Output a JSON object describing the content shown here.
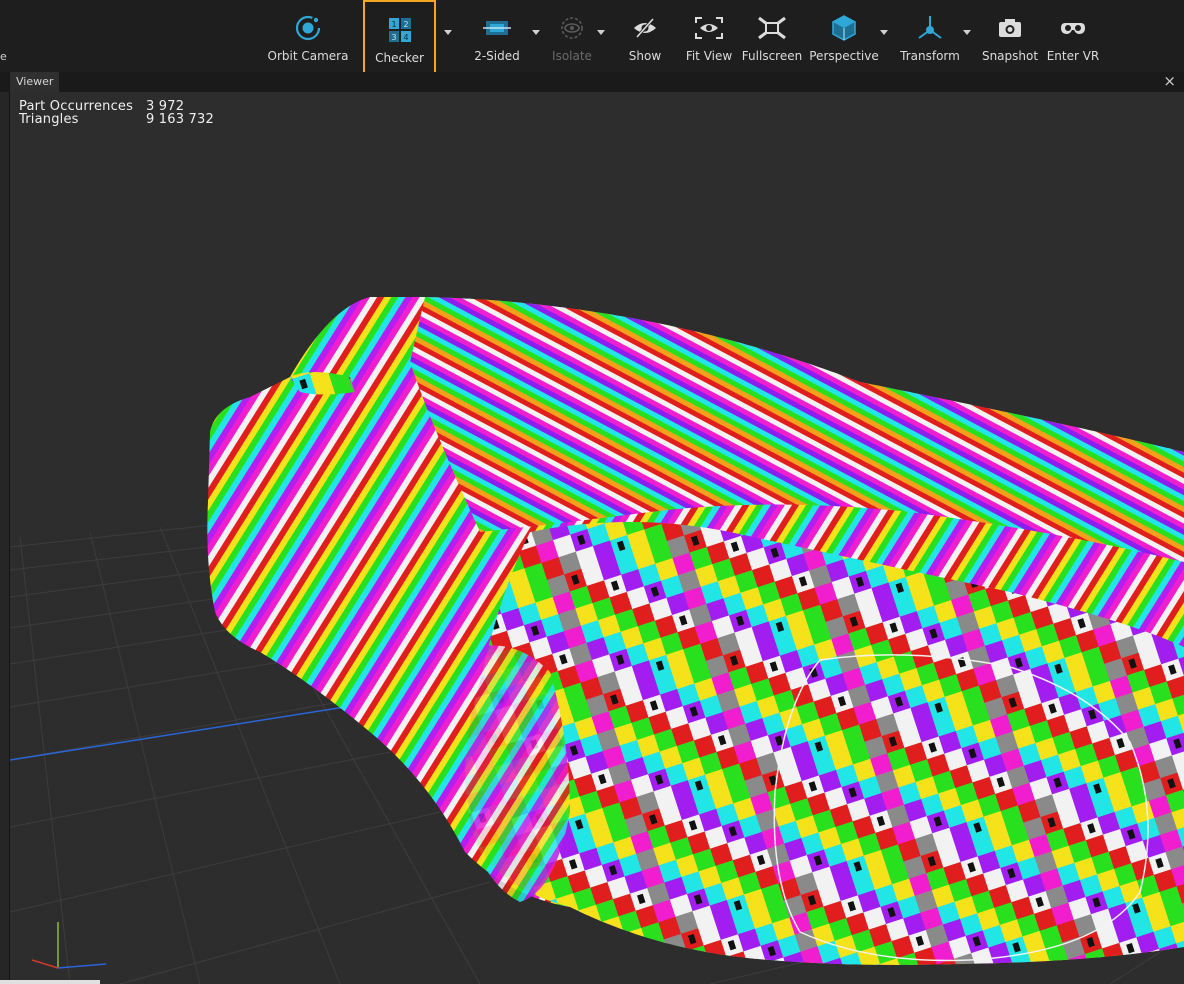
{
  "window": {
    "left_stub": "e"
  },
  "toolbar": {
    "orbit_camera": "Orbit Camera",
    "checker": "Checker",
    "two_sided": "2-Sided",
    "isolate": "Isolate",
    "show": "Show",
    "fit_view": "Fit View",
    "fullscreen": "Fullscreen",
    "perspective": "Perspective",
    "transform": "Transform",
    "snapshot": "Snapshot",
    "enter_vr": "Enter VR",
    "active_tool": "Checker",
    "accent_color": "#f5a623",
    "icon_color": "#2fa8d8"
  },
  "viewer": {
    "tab_label": "Viewer",
    "close_glyph": "×",
    "stats": {
      "part_occurrences_label": "Part Occurrences",
      "part_occurrences_value": "3 972",
      "triangles_label": "Triangles",
      "triangles_value": "9 163 732"
    },
    "scene": {
      "subject": "car-model-with-checker-texture",
      "background_color": "#2d2d2d",
      "grid_color": "#3d3d3d",
      "axis_x_color": "#d23a2a",
      "axis_y_color": "#8fbf2a",
      "axis_z_color": "#2a66d6"
    }
  }
}
